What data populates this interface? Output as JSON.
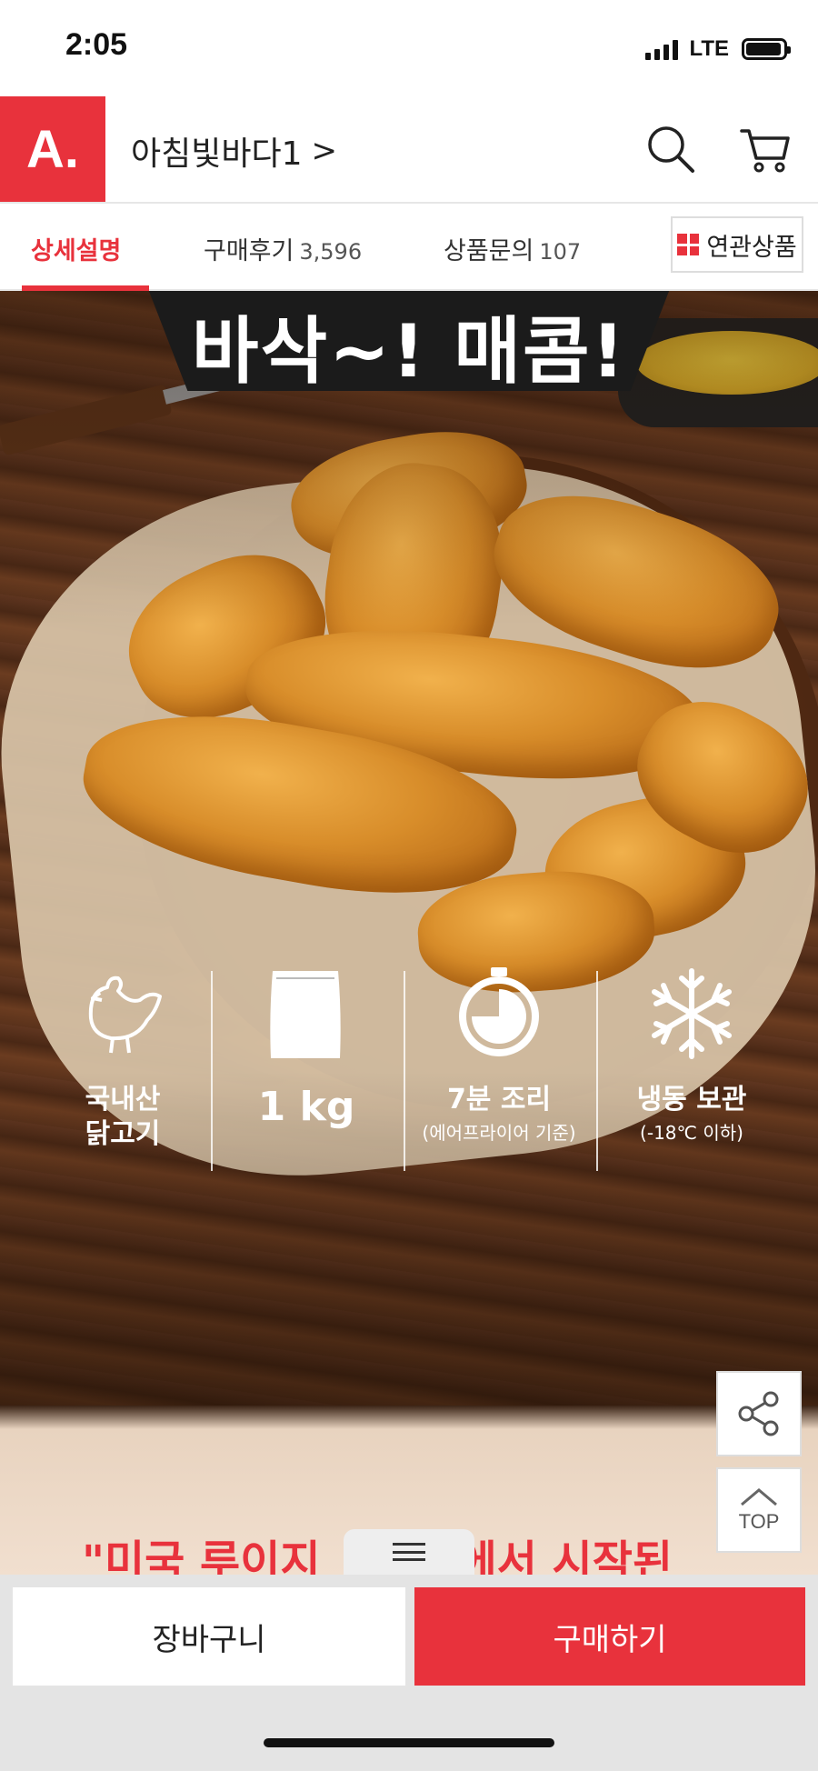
{
  "status_bar": {
    "time": "2:05",
    "network": "LTE"
  },
  "header": {
    "logo_text": "A.",
    "store_name": "아침빛바다1",
    "chevron": ">",
    "icons": [
      "search-icon",
      "cart-icon"
    ]
  },
  "tabs": {
    "items": [
      {
        "label": "상세설명",
        "count": ""
      },
      {
        "label": "구매후기",
        "count": "3,596"
      },
      {
        "label": "상품문의",
        "count": "107"
      }
    ],
    "active": "상세설명",
    "related_label": "연관상품"
  },
  "hero": {
    "headline": "바삭~! 매콤!",
    "badges": [
      {
        "line1": "국내산",
        "line2": "닭고기",
        "icon": "chicken-icon"
      },
      {
        "line1": "1 kg",
        "icon": "bag-icon"
      },
      {
        "line1": "7분 조리",
        "line2": "(에어프라이어 기준)",
        "icon": "timer-icon"
      },
      {
        "line1": "냉동 보관",
        "line2": "(-18℃ 이하)",
        "icon": "snowflake-icon"
      }
    ]
  },
  "content": {
    "quote_text": "\"미국 루이지",
    "quote_text2": "에서 시작된"
  },
  "floating": {
    "top_label": "TOP"
  },
  "bottom_bar": {
    "cart_label": "장바구니",
    "buy_label": "구매하기"
  },
  "colors": {
    "brand": "#e8323c"
  }
}
